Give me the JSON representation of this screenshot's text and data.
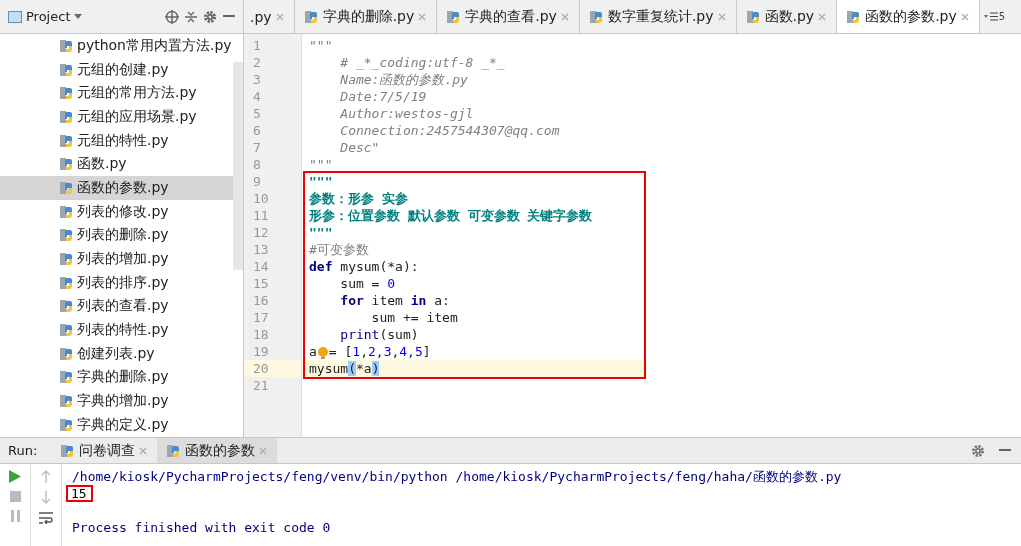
{
  "project_panel": {
    "title": "Project",
    "items": [
      {
        "label": "python常用内置方法.py",
        "selected": false
      },
      {
        "label": "元组的创建.py",
        "selected": false
      },
      {
        "label": "元组的常用方法.py",
        "selected": false
      },
      {
        "label": "元组的应用场景.py",
        "selected": false
      },
      {
        "label": "元组的特性.py",
        "selected": false
      },
      {
        "label": "函数.py",
        "selected": false
      },
      {
        "label": "函数的参数.py",
        "selected": true
      },
      {
        "label": "列表的修改.py",
        "selected": false
      },
      {
        "label": "列表的删除.py",
        "selected": false
      },
      {
        "label": "列表的增加.py",
        "selected": false
      },
      {
        "label": "列表的排序.py",
        "selected": false
      },
      {
        "label": "列表的查看.py",
        "selected": false
      },
      {
        "label": "列表的特性.py",
        "selected": false
      },
      {
        "label": "创建列表.py",
        "selected": false
      },
      {
        "label": "字典的删除.py",
        "selected": false
      },
      {
        "label": "字典的增加.py",
        "selected": false
      },
      {
        "label": "字典的定义.py",
        "selected": false
      }
    ]
  },
  "editor_tabs": [
    {
      "label": ".py",
      "selected": false
    },
    {
      "label": "字典的删除.py",
      "selected": false
    },
    {
      "label": "字典的查看.py",
      "selected": false
    },
    {
      "label": "数字重复统计.py",
      "selected": false
    },
    {
      "label": "函数.py",
      "selected": false
    },
    {
      "label": "函数的参数.py",
      "selected": true
    }
  ],
  "tab_overflow": "5",
  "code": {
    "lines": [
      {
        "number": "1",
        "boxed": false,
        "current": false,
        "tokens": [
          {
            "kind": "doc",
            "text": "\"\"\""
          }
        ]
      },
      {
        "number": "2",
        "boxed": false,
        "current": false,
        "tokens": [
          {
            "kind": "doc",
            "text": "    # _*_coding:utf-8 _*_"
          }
        ]
      },
      {
        "number": "3",
        "boxed": false,
        "current": false,
        "tokens": [
          {
            "kind": "doc",
            "text": "    Name:函数的参数.py"
          }
        ]
      },
      {
        "number": "4",
        "boxed": false,
        "current": false,
        "tokens": [
          {
            "kind": "doc",
            "text": "    Date:7/5/19"
          }
        ]
      },
      {
        "number": "5",
        "boxed": false,
        "current": false,
        "tokens": [
          {
            "kind": "doc",
            "text": "    Author:westos-gjl"
          }
        ]
      },
      {
        "number": "6",
        "boxed": false,
        "current": false,
        "tokens": [
          {
            "kind": "doc",
            "text": "    Connection:2457544307@qq.com"
          }
        ]
      },
      {
        "number": "7",
        "boxed": false,
        "current": false,
        "tokens": [
          {
            "kind": "doc",
            "text": "    Desc\""
          }
        ]
      },
      {
        "number": "8",
        "boxed": false,
        "current": false,
        "tokens": [
          {
            "kind": "doc",
            "text": "\"\"\""
          }
        ]
      },
      {
        "number": "9",
        "boxed": true,
        "current": false,
        "tokens": [
          {
            "kind": "docbold",
            "text": "\"\"\""
          }
        ]
      },
      {
        "number": "10",
        "boxed": true,
        "current": false,
        "tokens": [
          {
            "kind": "docbold",
            "text": "参数：形参 实参"
          }
        ]
      },
      {
        "number": "11",
        "boxed": true,
        "current": false,
        "tokens": [
          {
            "kind": "docbold",
            "text": "形参：位置参数 默认参数 可变参数 关键字参数"
          }
        ]
      },
      {
        "number": "12",
        "boxed": true,
        "current": false,
        "tokens": [
          {
            "kind": "docbold",
            "text": "\"\"\""
          }
        ]
      },
      {
        "number": "13",
        "boxed": true,
        "current": false,
        "tokens": [
          {
            "kind": "comment",
            "text": "#可变参数"
          }
        ]
      },
      {
        "number": "14",
        "boxed": true,
        "current": false,
        "tokens": [
          {
            "kind": "keyword",
            "text": "def"
          },
          {
            "kind": "plain",
            "text": " mysum(*a):"
          }
        ]
      },
      {
        "number": "15",
        "boxed": true,
        "current": false,
        "tokens": [
          {
            "kind": "plain",
            "text": "    sum = "
          },
          {
            "kind": "number",
            "text": "0"
          }
        ]
      },
      {
        "number": "16",
        "boxed": true,
        "current": false,
        "tokens": [
          {
            "kind": "indent"
          },
          {
            "kind": "keyword",
            "text": "for"
          },
          {
            "kind": "plain",
            "text": " item "
          },
          {
            "kind": "keyword",
            "text": "in"
          },
          {
            "kind": "plain",
            "text": " a:"
          }
        ]
      },
      {
        "number": "17",
        "boxed": true,
        "current": false,
        "tokens": [
          {
            "kind": "plain",
            "text": "        sum += item"
          }
        ]
      },
      {
        "number": "18",
        "boxed": true,
        "current": false,
        "tokens": [
          {
            "kind": "indent"
          },
          {
            "kind": "builtin",
            "text": "print"
          },
          {
            "kind": "plain",
            "text": "(sum)"
          }
        ]
      },
      {
        "number": "19",
        "boxed": true,
        "current": false,
        "tokens": [
          {
            "kind": "plain",
            "text": "a"
          },
          {
            "kind": "bulb"
          },
          {
            "kind": "plain",
            "text": "= ["
          },
          {
            "kind": "number",
            "text": "1"
          },
          {
            "kind": "plain",
            "text": ","
          },
          {
            "kind": "number",
            "text": "2"
          },
          {
            "kind": "plain",
            "text": ","
          },
          {
            "kind": "number",
            "text": "3"
          },
          {
            "kind": "plain",
            "text": ","
          },
          {
            "kind": "number",
            "text": "4"
          },
          {
            "kind": "plain",
            "text": ","
          },
          {
            "kind": "number",
            "text": "5"
          },
          {
            "kind": "plain",
            "text": "]"
          }
        ]
      },
      {
        "number": "20",
        "boxed": true,
        "current": true,
        "tokens": [
          {
            "kind": "plain",
            "text": "mysum"
          },
          {
            "kind": "paren",
            "text": "("
          },
          {
            "kind": "plain",
            "text": "*a"
          },
          {
            "kind": "paren",
            "text": ")"
          }
        ]
      },
      {
        "number": "21",
        "boxed": false,
        "current": false
      }
    ]
  },
  "run_panel": {
    "label": "Run:",
    "tabs": [
      {
        "label": "问卷调查",
        "selected": false
      },
      {
        "label": "函数的参数",
        "selected": true
      }
    ],
    "output": [
      {
        "kind": "system",
        "text": "/home/kiosk/PycharmProjects/feng/venv/bin/python /home/kiosk/PycharmProjects/feng/haha/函数的参数.py",
        "boxed": false
      },
      {
        "kind": "stdout",
        "text": "15",
        "boxed": true
      },
      {
        "kind": "gap"
      },
      {
        "kind": "system",
        "text": "Process finished with exit code 0",
        "boxed": false
      }
    ]
  }
}
